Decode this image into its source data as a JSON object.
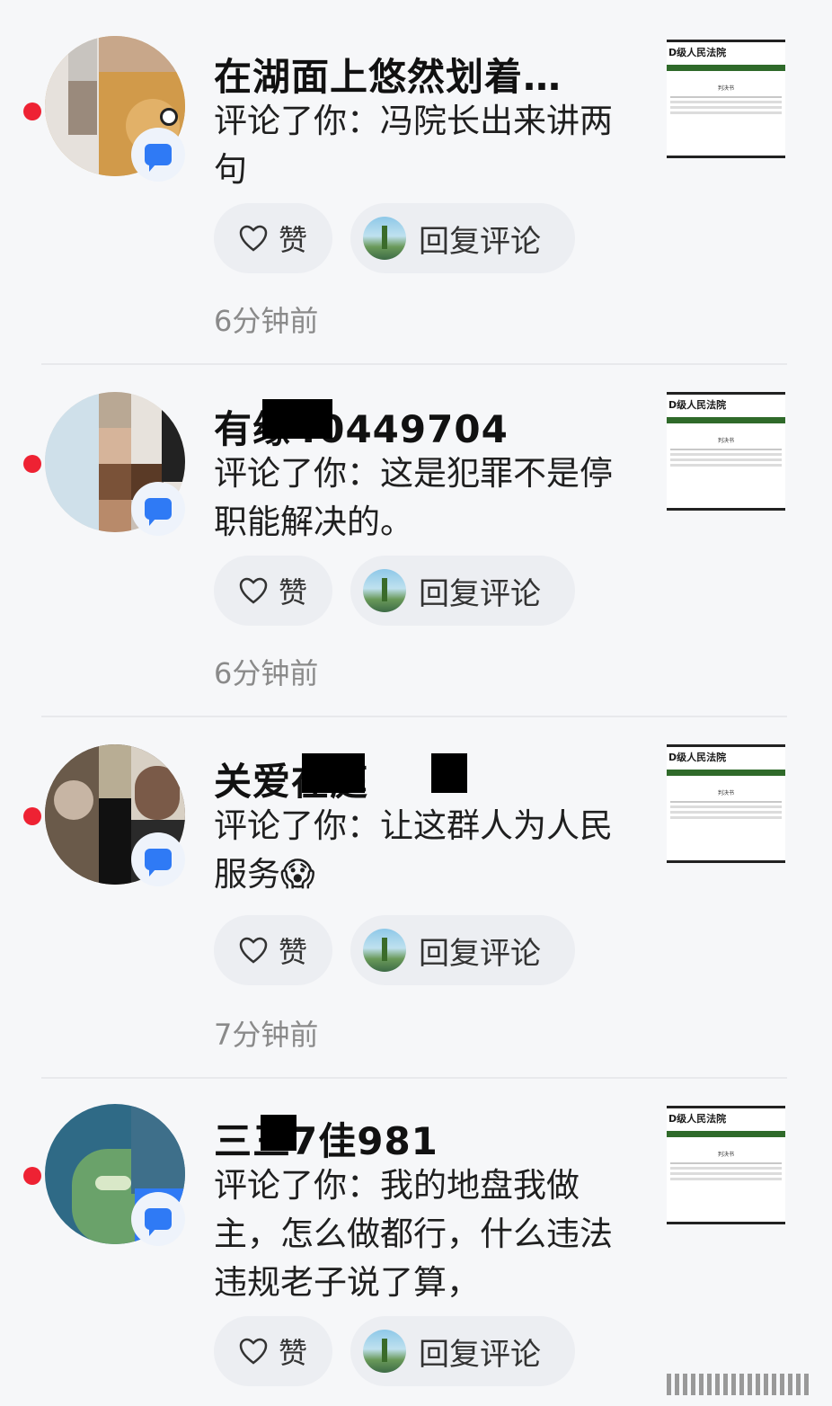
{
  "notifications": [
    {
      "name": "在湖面上悠然划着…",
      "comment": "评论了你：冯院长出来讲两句",
      "like_label": "赞",
      "reply_label": "回复评论",
      "time": "6分钟前",
      "thumb_title": "D级人民法院"
    },
    {
      "name": "有缘40449704",
      "comment": "评论了你：这是犯罪不是停职能解决的。",
      "like_label": "赞",
      "reply_label": "回复评论",
      "time": "6分钟前",
      "thumb_title": "D级人民法院"
    },
    {
      "name": "关爱在庭",
      "comment": "评论了你：让这群人为人民服务😱",
      "like_label": "赞",
      "reply_label": "回复评论",
      "time": "7分钟前",
      "thumb_title": "D级人民法院"
    },
    {
      "name": "三三7佳981",
      "comment": "评论了你：我的地盘我做主，怎么做都行，什么违法违规老子说了算，",
      "like_label": "赞",
      "reply_label": "回复评论",
      "time": "",
      "thumb_title": "D级人民法院"
    }
  ],
  "thumb_heading": "判决书",
  "colors": {
    "unread_dot": "#ee2233",
    "badge_blue": "#2f7af5",
    "page_bg": "#f6f7f9"
  },
  "icons": {
    "like": "heart-icon",
    "comment_badge": "comment-bubble-icon",
    "unread": "unread-dot-icon"
  }
}
